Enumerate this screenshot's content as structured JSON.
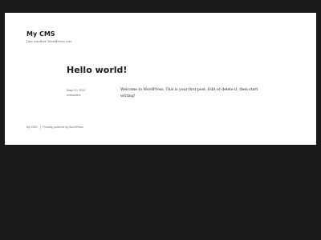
{
  "header": {
    "site_title": "My CMS",
    "site_description": "Just another WordPress site"
  },
  "post": {
    "title": "Hello world!",
    "date": "Mayo 10, 2019",
    "author": "rootsamerz",
    "content": "Welcome to WordPress. This is your first post. Edit or delete it, then start writing!"
  },
  "footer": {
    "site_link": "My CMS",
    "powered_by": "Proudly powered by WordPress"
  }
}
